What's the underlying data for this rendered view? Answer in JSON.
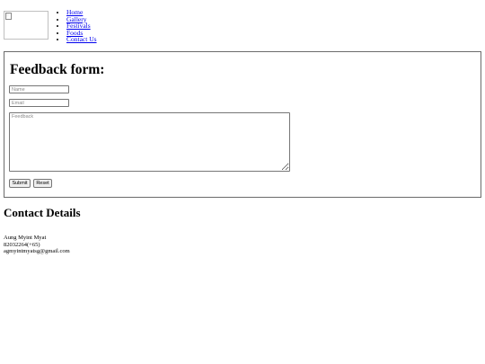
{
  "nav": {
    "items": [
      {
        "label": "Home"
      },
      {
        "label": "Gallery"
      },
      {
        "label": "Festivals"
      },
      {
        "label": "Foods"
      },
      {
        "label": "Contact Us"
      }
    ]
  },
  "form": {
    "title": "Feedback form:",
    "name_placeholder": "Name",
    "email_placeholder": "Email",
    "feedback_placeholder": "Feedback",
    "submit_label": "Submit",
    "reset_label": "Reset"
  },
  "contact": {
    "title": "Contact Details",
    "name": "Aung Myint Myat",
    "phone": "82032264(+65)",
    "email": "agmyintmyatsg@gmail.com"
  }
}
